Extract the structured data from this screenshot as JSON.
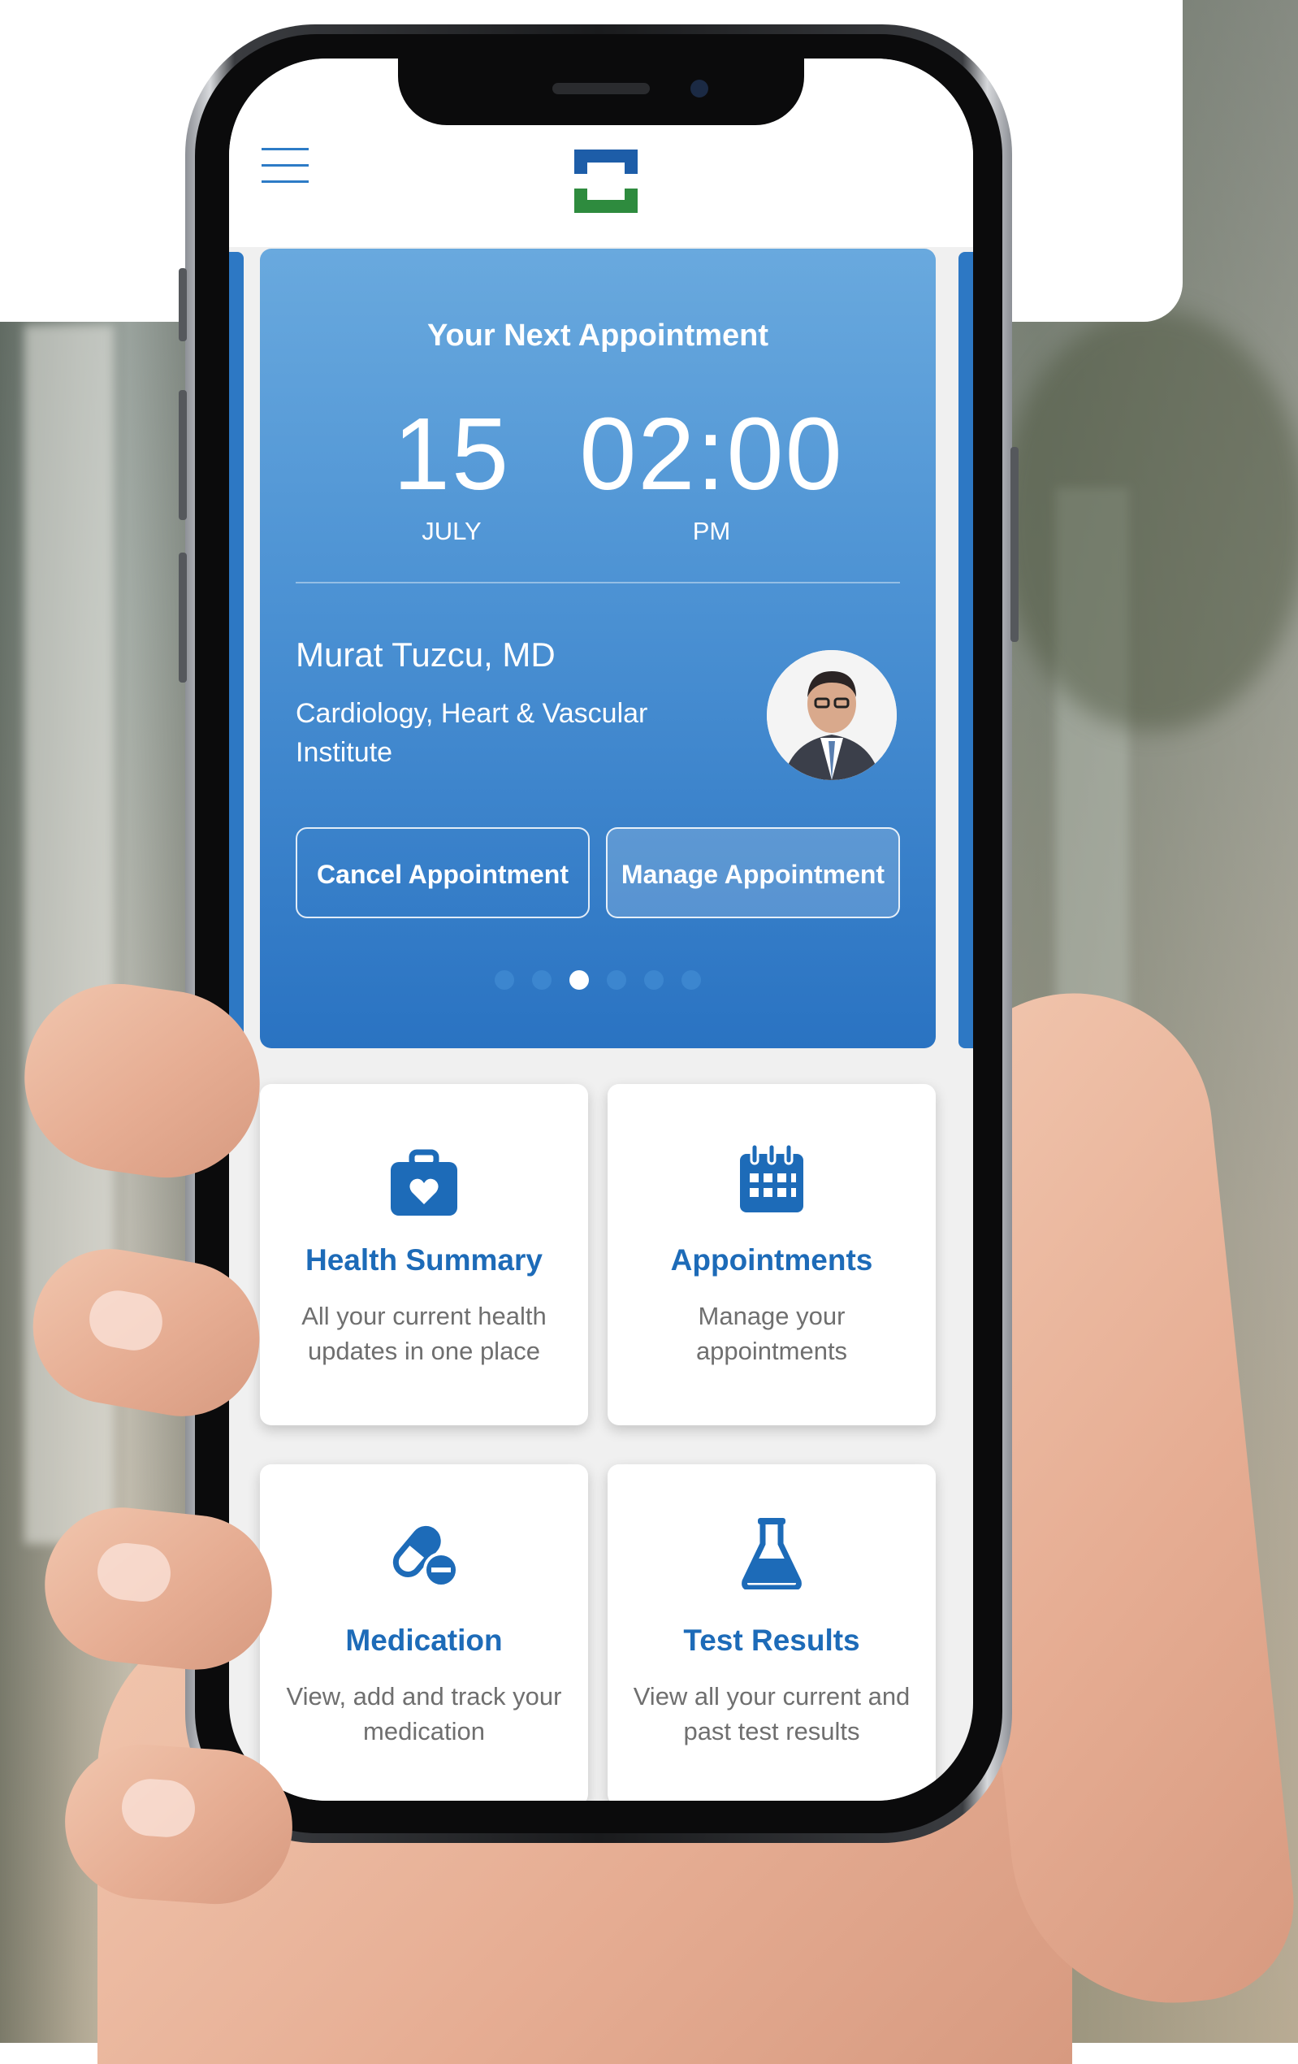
{
  "app": {
    "header": {
      "menu_icon": "hamburger-menu-icon",
      "logo_icon": "clinic-cross-logo-icon"
    },
    "appointment_card": {
      "title": "Your Next Appointment",
      "day": "15",
      "month": "JULY",
      "time": "02:00",
      "meridiem": "PM",
      "doctor_name": "Murat Tuzcu, MD",
      "department": "Cardiology, Heart & Vascular Institute",
      "cancel_label": "Cancel Appointment",
      "manage_label": "Manage Appointment",
      "pagination": {
        "total": 6,
        "active_index": 2
      }
    },
    "tiles": [
      {
        "icon": "medical-bag-heart-icon",
        "title": "Health Summary",
        "description": "All your current health updates in one place"
      },
      {
        "icon": "calendar-icon",
        "title": "Appointments",
        "description": "Manage your appointments"
      },
      {
        "icon": "pills-icon",
        "title": "Medication",
        "description": "View, add and track your medication"
      },
      {
        "icon": "flask-icon",
        "title": "Test Results",
        "description": "View all your current and past test results"
      }
    ]
  },
  "colors": {
    "accent_blue": "#1d6bb8",
    "card_gradient_top": "#69a9de",
    "card_gradient_bottom": "#2a73c2",
    "logo_blue": "#1d5da8",
    "logo_green": "#2e8b3e"
  }
}
